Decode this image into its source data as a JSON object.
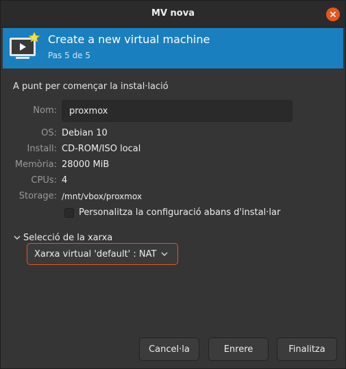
{
  "window": {
    "title": "MV nova"
  },
  "header": {
    "title": "Create a new virtual machine",
    "subtitle": "Pas 5 de 5",
    "icon": "virtual-machine-new-icon",
    "bg_color": "#1a7fbf"
  },
  "body": {
    "ready_text": "A punt per començar la instal·lació",
    "name_label": "Nom:",
    "name_value": "proxmox",
    "details": [
      {
        "label": "OS:",
        "value": "Debian 10"
      },
      {
        "label": "Install:",
        "value": "CD-ROM/ISO local"
      },
      {
        "label": "Memòria:",
        "value": "28000 MiB"
      },
      {
        "label": "CPUs:",
        "value": "4"
      },
      {
        "label": "Storage:",
        "value": "/mnt/vbox/proxmox"
      }
    ],
    "customize_checkbox": {
      "label": "Personalitza la configuració abans d'instal·lar",
      "checked": false
    },
    "network": {
      "expander_label": "Selecció de la xarxa",
      "selected": "Xarxa virtual 'default' : NAT",
      "accent_color": "#e95420"
    }
  },
  "buttons": {
    "cancel": "Cancel·la",
    "back": "Enrere",
    "finish": "Finalitza"
  }
}
